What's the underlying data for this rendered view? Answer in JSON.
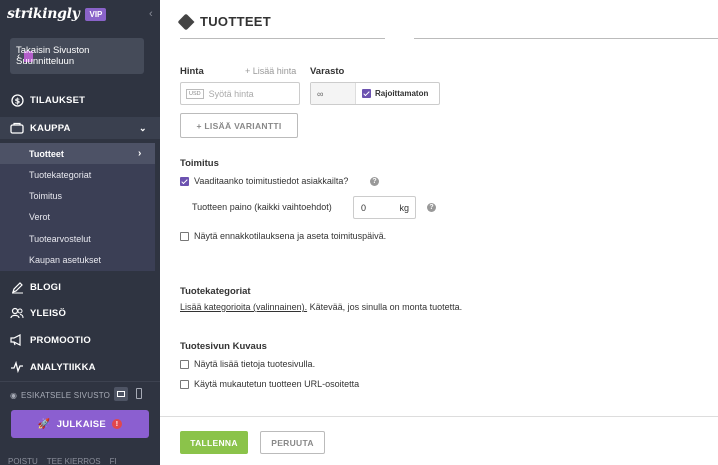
{
  "sidebar": {
    "brand": "strikingly",
    "vip_badge": "VIP",
    "back_label": "Takaisin Sivuston Suunnitteluun",
    "nav": {
      "orders": "TILAUKSET",
      "store": "KAUPPA",
      "blog": "BLOGI",
      "general": "YLEISÖ",
      "promotion": "PROMOOTIO",
      "analytics": "ANALYTIIKKA"
    },
    "store_sub": [
      "Tuotteet",
      "Tuotekategoriat",
      "Toimitus",
      "Verot",
      "Tuotearvostelut",
      "Kaupan asetukset"
    ],
    "preview_label": "ESIKATSELE SIVUSTO",
    "publish_label": "JULKAISE",
    "publish_badge": "!",
    "bottom_links": [
      "POISTU",
      "TEE KIERROS",
      "FI"
    ]
  },
  "main": {
    "title": "TUOTTEET",
    "price_label": "Hinta",
    "add_price_label": "+ Lisää hinta",
    "currency": "USD",
    "price_placeholder": "Syötä hinta",
    "stock_label": "Varasto",
    "stock_infinity": "∞",
    "stock_unlimited": "Rajoittamaton",
    "add_variant": "+ LISÄÄ VARIANTTI",
    "shipping_heading": "Toimitus",
    "require_shipping": "Vaaditaanko toimitustiedot asiakkailta?",
    "weight_label": "Tuotteen paino (kaikki vaihtoehdot)",
    "weight_value": "0",
    "weight_unit": "kg",
    "preorder_label": "Näytä ennakkotilauksena ja aseta toimituspäivä.",
    "categories_heading": "Tuotekategoriat",
    "categories_link": "Lisää kategorioita (valinnainen).",
    "categories_text": " Kätevää, jos sinulla on monta tuotetta.",
    "description_heading": "Tuotesivun Kuvaus",
    "desc_option_1": "Näytä lisää tietoja tuotesivulla.",
    "desc_option_2": "Käytä mukautetun tuotteen URL-osoitetta",
    "save_label": "TALLENNA",
    "cancel_label": "PERUUTA"
  },
  "colors": {
    "sidebar_bg": "#2f3441",
    "accent_purple": "#8b5fd0",
    "save_green": "#8bc34a"
  }
}
